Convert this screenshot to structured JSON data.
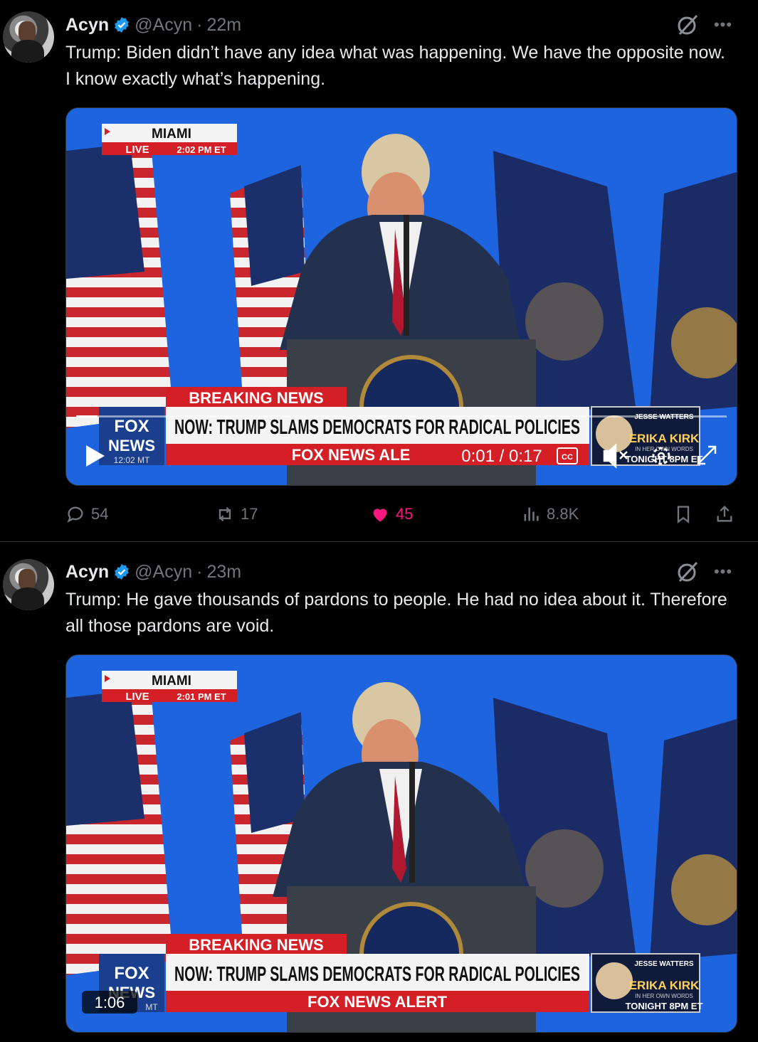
{
  "tweets": [
    {
      "author": "Acyn",
      "handle": "@Acyn",
      "separator": "·",
      "time": "22m",
      "text": "Trump: Biden didn’t have any idea what was happening. We have the opposite now. I know exactly what’s happening.",
      "video": {
        "location": "MIAMI",
        "live_label": "LIVE",
        "live_time": "2:02 PM ET",
        "breaking": "BREAKING NEWS",
        "headline": "NOW: TRUMP SLAMS DEMOCRATS FOR RADICAL POLICIES",
        "alert": "FOX NEWS ALE",
        "logo_top": "FOX",
        "logo_bottom": "NEWS",
        "logo_time": "12:02 MT",
        "promo_top": "JESSE WATTERS",
        "promo_name": "ERIKA KIRK",
        "promo_sub": "IN HER OWN WORDS",
        "promo_time": "TONIGHT 8PM ET",
        "player_time": "0:01 / 0:17",
        "cc": "CC"
      },
      "stats": {
        "replies": "54",
        "reposts": "17",
        "likes": "45",
        "views": "8.8K"
      }
    },
    {
      "author": "Acyn",
      "handle": "@Acyn",
      "separator": "·",
      "time": "23m",
      "text": "Trump: He gave thousands of pardons to people. He had no idea about it. Therefore all those pardons are void.",
      "video": {
        "location": "MIAMI",
        "live_label": "LIVE",
        "live_time": "2:01 PM ET",
        "breaking": "BREAKING NEWS",
        "headline": "NOW: TRUMP SLAMS DEMOCRATS FOR RADICAL POLICIES",
        "alert": "FOX NEWS ALERT",
        "logo_top": "FOX",
        "logo_bottom": "NEWS",
        "logo_time": "MT",
        "promo_top": "JESSE WATTERS",
        "promo_name": "ERIKA KIRK",
        "promo_sub": "IN HER OWN WORDS",
        "promo_time": "TONIGHT 8PM ET",
        "duration": "1:06"
      }
    }
  ],
  "colors": {
    "like": "#f91880",
    "verified": "#1d9bf0",
    "muted": "#71767b",
    "fox_red": "#d41f26"
  }
}
